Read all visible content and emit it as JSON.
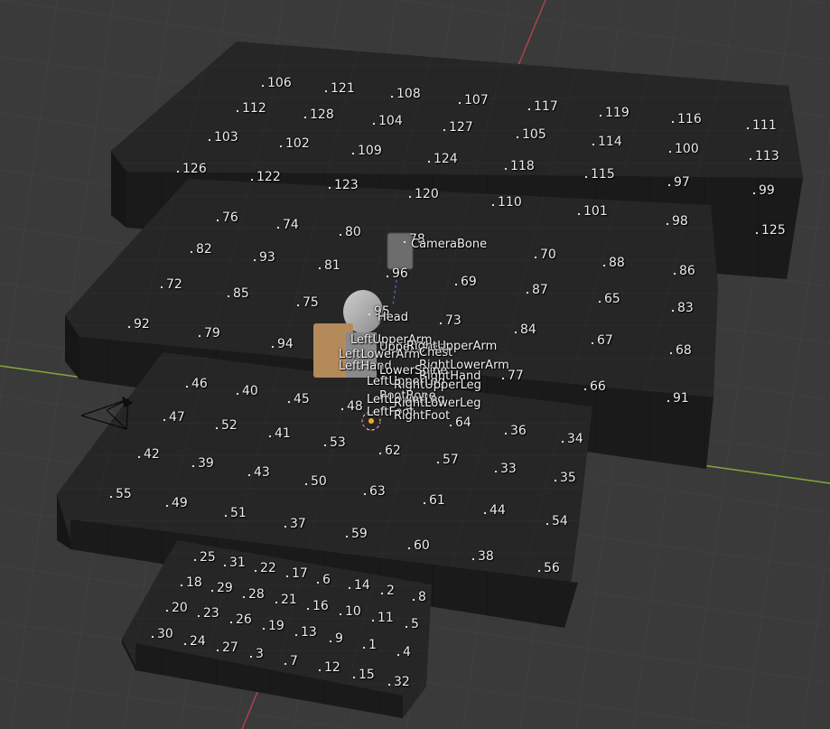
{
  "scene": {
    "colors": {
      "background": "#3a3a3a",
      "grid": "#444444",
      "x_axis": "#b0424c",
      "y_axis": "#84a83a",
      "block_top": "#262626",
      "block_side": "#1e1e1e",
      "block_front": "#161616",
      "label": "#ececec"
    },
    "cube_numbers": [
      "106",
      "121",
      "108",
      "107",
      "117",
      "119",
      "116",
      "111",
      "112",
      "128",
      "104",
      "127",
      "105",
      "114",
      "100",
      "113",
      "103",
      "102",
      "109",
      "124",
      "118",
      "115",
      "97",
      "99",
      "126",
      "122",
      "123",
      "120",
      "110",
      "101",
      "98",
      "125",
      "76",
      "74",
      "80",
      "78",
      "70",
      "88",
      "86",
      "82",
      "93",
      "81",
      "96",
      "69",
      "87",
      "65",
      "83",
      "72",
      "85",
      "75",
      "95",
      "73",
      "84",
      "67",
      "68",
      "92",
      "79",
      "94",
      "77",
      "66",
      "91",
      "46",
      "40",
      "45",
      "48",
      "64",
      "36",
      "34",
      "47",
      "52",
      "41",
      "53",
      "62",
      "57",
      "33",
      "35",
      "42",
      "39",
      "43",
      "50",
      "63",
      "61",
      "44",
      "54",
      "55",
      "49",
      "51",
      "37",
      "59",
      "60",
      "38",
      "56",
      "25",
      "31",
      "22",
      "17",
      "6",
      "14",
      "2",
      "8",
      "18",
      "29",
      "28",
      "21",
      "16",
      "10",
      "11",
      "5",
      "20",
      "23",
      "26",
      "19",
      "13",
      "9",
      "1",
      "4",
      "30",
      "24",
      "27",
      "3",
      "7",
      "12",
      "15",
      "32"
    ],
    "bone_names": [
      "CameraBone",
      "Head",
      "LeftUpperArm",
      "UpperChest",
      "RightUpperArm",
      "LeftLowerArm",
      "Chest",
      "LeftHand",
      "RightLowerArm",
      "LowerSpine",
      "RightHand",
      "LeftUpperLeg",
      "RightUpperLeg",
      "RootBone",
      "LeftLowerLeg",
      "RightLowerLeg",
      "LeftFoot",
      "RightFoot"
    ]
  }
}
